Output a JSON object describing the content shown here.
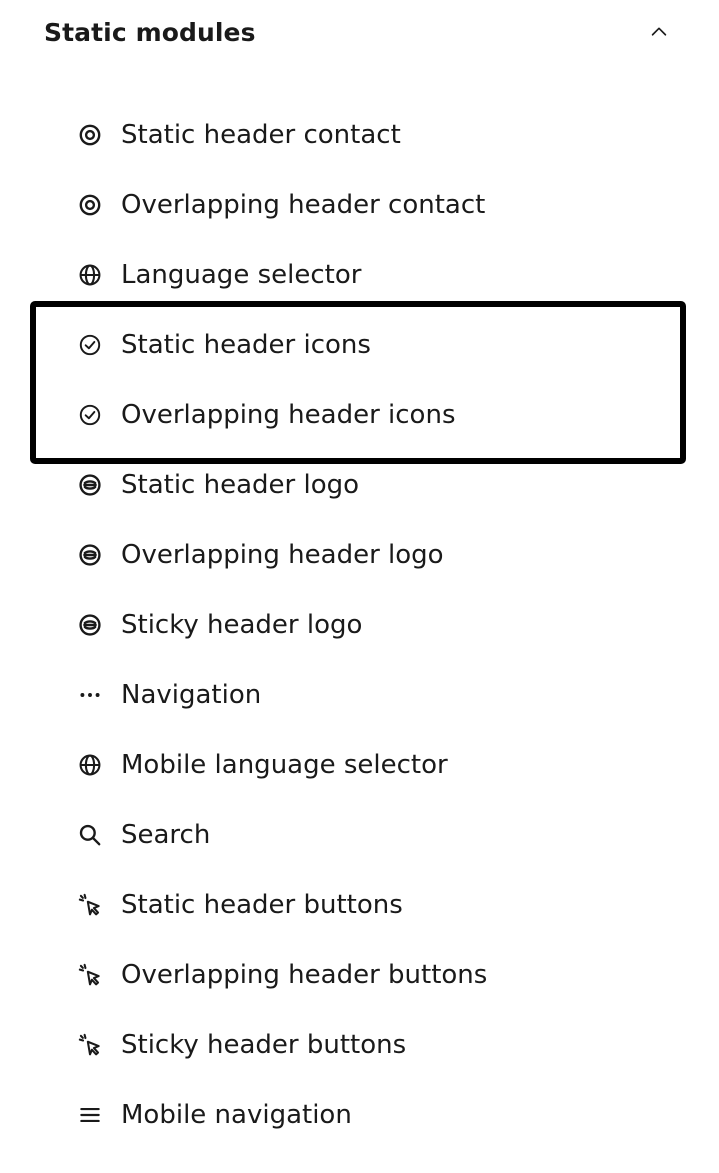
{
  "section": {
    "title": "Static modules",
    "expanded": true,
    "toggle_icon": "chevron-up-icon"
  },
  "modules": [
    {
      "label": "Static header contact",
      "icon": "target-icon"
    },
    {
      "label": "Overlapping header contact",
      "icon": "target-icon"
    },
    {
      "label": "Language selector",
      "icon": "globe-icon"
    },
    {
      "label": "Static header icons",
      "icon": "check-circle-icon"
    },
    {
      "label": "Overlapping header icons",
      "icon": "check-circle-icon"
    },
    {
      "label": "Static header logo",
      "icon": "logo-icon"
    },
    {
      "label": "Overlapping header logo",
      "icon": "logo-icon"
    },
    {
      "label": "Sticky header logo",
      "icon": "logo-icon"
    },
    {
      "label": "Navigation",
      "icon": "ellipsis-icon"
    },
    {
      "label": "Mobile language selector",
      "icon": "globe-icon"
    },
    {
      "label": "Search",
      "icon": "search-icon"
    },
    {
      "label": "Static header buttons",
      "icon": "cursor-click-icon"
    },
    {
      "label": "Overlapping header buttons",
      "icon": "cursor-click-icon"
    },
    {
      "label": "Sticky header buttons",
      "icon": "cursor-click-icon"
    },
    {
      "label": "Mobile navigation",
      "icon": "menu-icon"
    }
  ],
  "highlight": {
    "color": "#000000"
  },
  "colors": {
    "text": "#1a1a1a",
    "background": "#ffffff"
  }
}
